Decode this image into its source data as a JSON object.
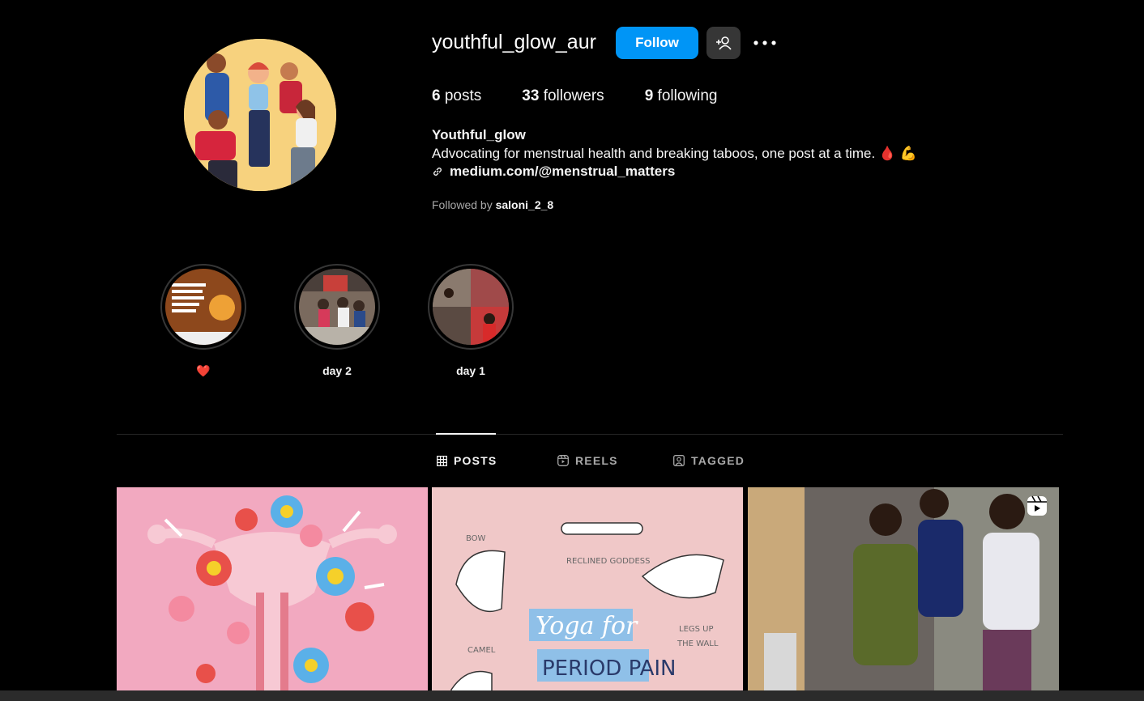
{
  "profile": {
    "username": "youthful_glow_aur",
    "follow_label": "Follow",
    "stats": {
      "posts_count": "6",
      "posts_label": "posts",
      "followers_count": "33",
      "followers_label": "followers",
      "following_count": "9",
      "following_label": "following"
    },
    "full_name": "Youthful_glow",
    "bio": "Advocating for menstrual health and breaking taboos, one post at a time. 🩸 💪",
    "link": "medium.com/@menstrual_matters",
    "followed_by_prefix": "Followed by",
    "followed_by_user": "saloni_2_8"
  },
  "highlights": [
    {
      "label": "❤️",
      "icon": "highlight-cover-festival-quote"
    },
    {
      "label": "day 2",
      "icon": "highlight-cover-group-photo"
    },
    {
      "label": "day 1",
      "icon": "highlight-cover-event-collage"
    }
  ],
  "tabs": [
    {
      "label": "POSTS",
      "icon": "grid-icon",
      "active": true
    },
    {
      "label": "REELS",
      "icon": "reels-icon",
      "active": false
    },
    {
      "label": "TAGGED",
      "icon": "tagged-icon",
      "active": false
    }
  ],
  "posts": [
    {
      "kind": "image",
      "icon": "flower-uterus-illustration"
    },
    {
      "kind": "image",
      "icon": "yoga-poses-illustration",
      "texts": [
        "BOW",
        "RECLINED GODDESS",
        "Yoga for",
        "PERIOD PAIN",
        "LEGS UP",
        "THE WALL",
        "CAMEL"
      ]
    },
    {
      "kind": "reel",
      "icon": "reel-badge-icon"
    }
  ],
  "colors": {
    "background": "#000000",
    "accent": "#0095f6",
    "secondary_button": "#363636",
    "muted_text": "#a8a8a8"
  }
}
